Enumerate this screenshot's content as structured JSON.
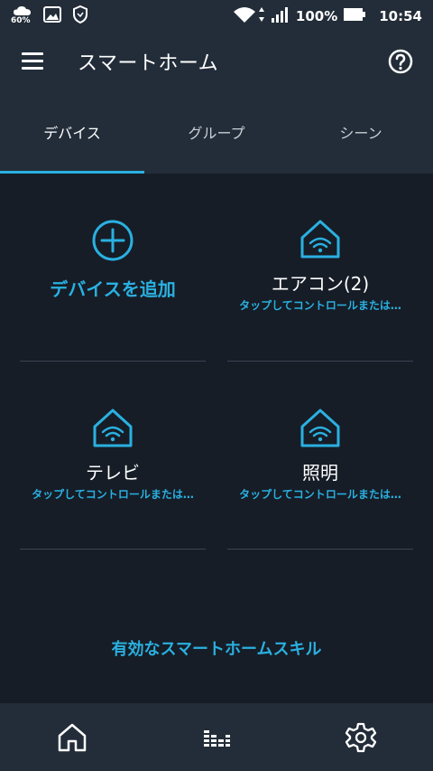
{
  "status_bar": {
    "weather_percent": "60%",
    "battery_percent": "100%",
    "time": "10:54"
  },
  "app_bar": {
    "title": "スマートホーム"
  },
  "tabs": [
    {
      "label": "デバイス",
      "active": true
    },
    {
      "label": "グループ",
      "active": false
    },
    {
      "label": "シーン",
      "active": false
    }
  ],
  "add_device": {
    "label": "デバイスを追加",
    "icon": "plus-circle-icon"
  },
  "devices": [
    {
      "name": "エアコン(2)",
      "subtitle": "タップしてコントロールまたは…",
      "icon": "smart-home-icon"
    },
    {
      "name": "テレビ",
      "subtitle": "タップしてコントロールまたは…",
      "icon": "smart-home-icon"
    },
    {
      "name": "照明",
      "subtitle": "タップしてコントロールまたは…",
      "icon": "smart-home-icon"
    }
  ],
  "skills_link": "有効なスマートホームスキル",
  "bottom_nav": [
    {
      "icon": "home-icon"
    },
    {
      "icon": "equalizer-icon"
    },
    {
      "icon": "settings-gear-icon"
    }
  ],
  "colors": {
    "accent": "#2ab0e0",
    "background": "#161d27",
    "bar": "#232d39"
  }
}
